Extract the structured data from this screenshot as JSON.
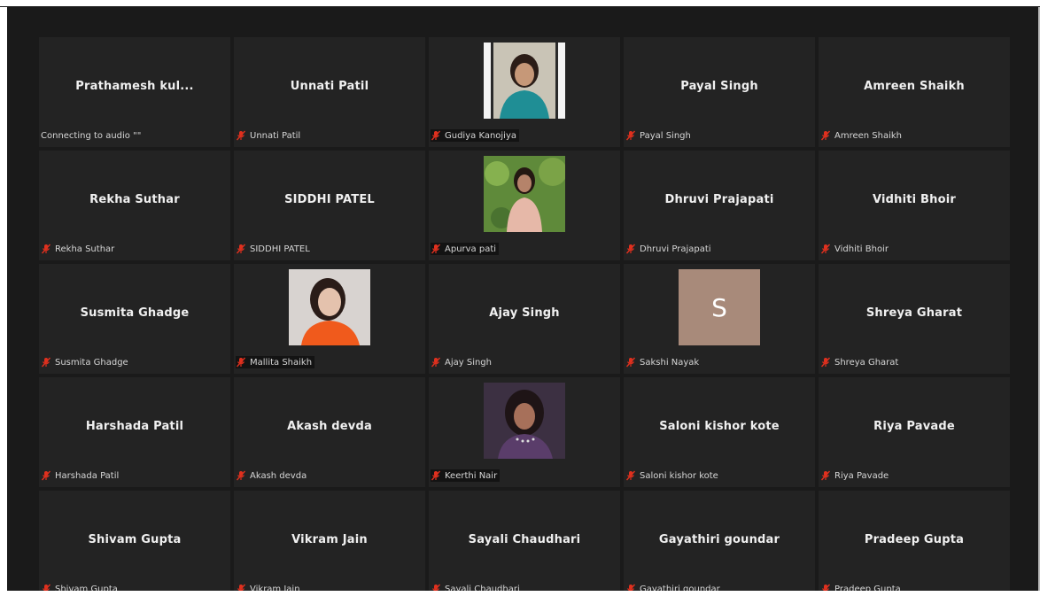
{
  "meeting": {
    "participants": [
      {
        "display_name": "Prathamesh  kul...",
        "footer_label": "Connecting to audio \"\"",
        "muted": false,
        "media": "name"
      },
      {
        "display_name": "Unnati Patil",
        "footer_label": "Unnati Patil",
        "muted": true,
        "media": "name"
      },
      {
        "display_name": "",
        "footer_label": "Gudiya Kanojiya",
        "muted": true,
        "media": "photo",
        "photo": "woman-teal-top"
      },
      {
        "display_name": "Payal Singh",
        "footer_label": "Payal Singh",
        "muted": true,
        "media": "name"
      },
      {
        "display_name": "Amreen Shaikh",
        "footer_label": "Amreen Shaikh",
        "muted": true,
        "media": "name"
      },
      {
        "display_name": "Rekha Suthar",
        "footer_label": "Rekha Suthar",
        "muted": true,
        "media": "name"
      },
      {
        "display_name": "SIDDHI PATEL",
        "footer_label": "SIDDHI PATEL",
        "muted": true,
        "media": "name"
      },
      {
        "display_name": "",
        "footer_label": "Apurva pati",
        "muted": true,
        "media": "photo",
        "photo": "woman-garden"
      },
      {
        "display_name": "Dhruvi Prajapati",
        "footer_label": "Dhruvi Prajapati",
        "muted": true,
        "media": "name"
      },
      {
        "display_name": "Vidhiti Bhoir",
        "footer_label": "Vidhiti Bhoir",
        "muted": true,
        "media": "name"
      },
      {
        "display_name": "Susmita Ghadge",
        "footer_label": "Susmita Ghadge",
        "muted": true,
        "media": "name"
      },
      {
        "display_name": "",
        "footer_label": "Mallita Shaikh",
        "muted": true,
        "media": "photo",
        "photo": "woman-orange-top"
      },
      {
        "display_name": "Ajay Singh",
        "footer_label": "Ajay Singh",
        "muted": true,
        "media": "name"
      },
      {
        "display_name": "",
        "footer_label": "Sakshi Nayak",
        "muted": true,
        "media": "avatar",
        "avatar_letter": "S"
      },
      {
        "display_name": "Shreya Gharat",
        "footer_label": "Shreya Gharat",
        "muted": true,
        "media": "name"
      },
      {
        "display_name": "Harshada Patil",
        "footer_label": "Harshada Patil",
        "muted": true,
        "media": "name"
      },
      {
        "display_name": "Akash devda",
        "footer_label": "Akash devda",
        "muted": true,
        "media": "name"
      },
      {
        "display_name": "",
        "footer_label": "Keerthi Nair",
        "muted": true,
        "media": "photo",
        "photo": "woman-dark"
      },
      {
        "display_name": "Saloni kishor kote",
        "footer_label": "Saloni kishor kote",
        "muted": true,
        "media": "name"
      },
      {
        "display_name": "Riya Pavade",
        "footer_label": "Riya Pavade",
        "muted": true,
        "media": "name"
      },
      {
        "display_name": "Shivam Gupta",
        "footer_label": "Shivam Gupta",
        "muted": true,
        "media": "name"
      },
      {
        "display_name": "Vikram Jain",
        "footer_label": "Vikram Jain",
        "muted": true,
        "media": "name"
      },
      {
        "display_name": "Sayali Chaudhari",
        "footer_label": "Sayali Chaudhari",
        "muted": true,
        "media": "name"
      },
      {
        "display_name": "Gayathiri goundar",
        "footer_label": "Gayathiri goundar",
        "muted": true,
        "media": "name"
      },
      {
        "display_name": "Pradeep Gupta",
        "footer_label": "Pradeep Gupta",
        "muted": true,
        "media": "name"
      }
    ]
  },
  "colors": {
    "background": "#1a1a1a",
    "tile": "#232323",
    "mute_icon": "#e0301e",
    "title_red": "#cc1111",
    "avatar_bg": "#a88a7a"
  }
}
